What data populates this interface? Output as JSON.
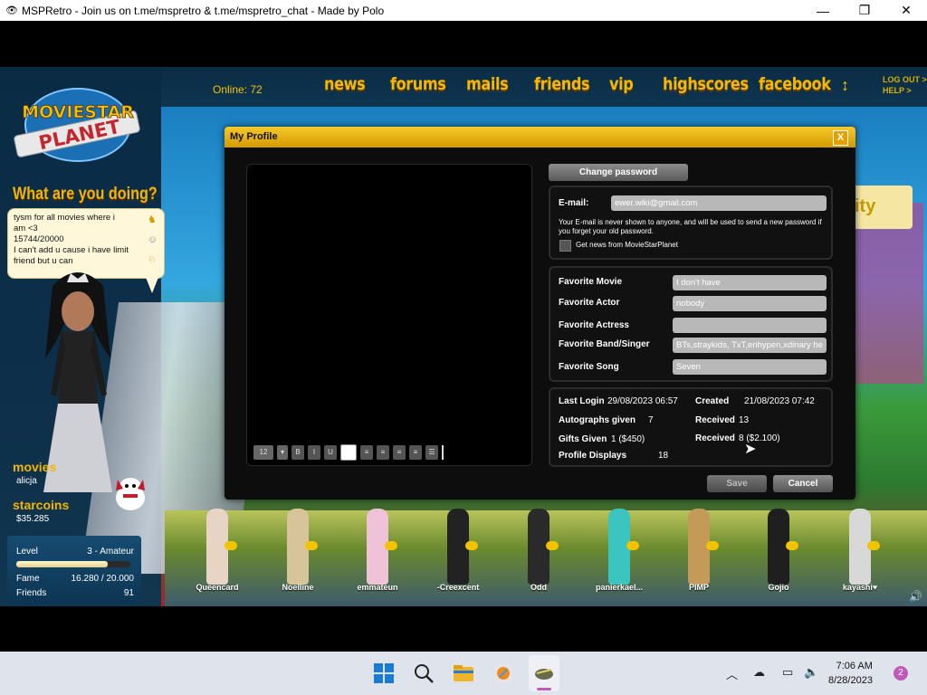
{
  "window": {
    "title": "MSPRetro - Join us on t.me/mspretro & t.me/mspretro_chat - Made by Polo",
    "min_label": "—",
    "max_label": "❐",
    "close_label": "✕"
  },
  "nav": {
    "online": "Online: 72",
    "items": [
      "news",
      "forums",
      "mails",
      "friends",
      "vip",
      "highscores",
      "facebook"
    ],
    "arrows": "↕",
    "logout": "LOG OUT >",
    "help": "HELP >"
  },
  "sidebar": {
    "logo_top": "MOVIESTAR",
    "logo_bottom": "PLANET",
    "what_doing": "What are you doing?",
    "status_lines": [
      "tysm for all movies where i",
      "am <3",
      "15744/20000",
      "I can't add u cause i have limit",
      "friend but u can"
    ],
    "movies_title": "movies",
    "username": "alicja",
    "starcoins_title": "starcoins",
    "money": "$35.285",
    "level_label": "Level",
    "level_value": "3 - Amateur",
    "level_progress": 0.8,
    "fame_label": "Fame",
    "fame_value": "16.280 / 20.000",
    "friends_label": "Friends",
    "friends_value": "91"
  },
  "background": {
    "card_text": "ity"
  },
  "dialog": {
    "title": "My Profile",
    "close": "X",
    "change_password": "Change password",
    "email_label": "E-mail:",
    "email_value": "ewer.wiki@gmail.com",
    "email_note": "Your E-mail is never shown to anyone, and will be used to send a new password if you forget your old password.",
    "news_label": "Get news from MovieStarPlanet",
    "favorites": [
      {
        "label": "Favorite Movie",
        "value": "I don't have"
      },
      {
        "label": "Favorite Actor",
        "value": "nobody"
      },
      {
        "label": "Favorite Actress",
        "value": ""
      },
      {
        "label": "Favorite Band/Singer",
        "value": "BTs,straykids, TxT,enhypen,xdinary he"
      },
      {
        "label": "Favorite Song",
        "value": "Seven"
      }
    ],
    "stats": {
      "last_login_label": "Last Login",
      "last_login_value": "29/08/2023 06:57",
      "created_label": "Created",
      "created_value": "21/08/2023 07:42",
      "autographs_label": "Autographs given",
      "autographs_value": "7",
      "received_label": "Received",
      "received_autographs": "13",
      "gifts_label": "Gifts Given",
      "gifts_value": "1 ($450)",
      "received_gifts": "8 ($2.100)",
      "profile_displays_label": "Profile Displays",
      "profile_displays_value": "18"
    },
    "editor": {
      "font_size": "12",
      "bold": "B",
      "italic": "I",
      "underline": "U"
    },
    "save": "Save",
    "cancel": "Cancel"
  },
  "friends": [
    {
      "name": "Queencard",
      "color": "#e8d4c4"
    },
    {
      "name": "Noelline",
      "color": "#d8c49a"
    },
    {
      "name": "emmateun",
      "color": "#f0c2d8"
    },
    {
      "name": "-Creexcent",
      "color": "#222222"
    },
    {
      "name": "Odd",
      "color": "#2a2a2a"
    },
    {
      "name": "panierkael...",
      "color": "#3bc4c0"
    },
    {
      "name": "PIMP",
      "color": "#c49a58"
    },
    {
      "name": "Gojio",
      "color": "#1f1f1f"
    },
    {
      "name": "kayashi♥",
      "color": "#d8d8d8"
    }
  ],
  "taskbar": {
    "time": "7:06 AM",
    "date": "8/28/2023",
    "notifications": "2"
  }
}
